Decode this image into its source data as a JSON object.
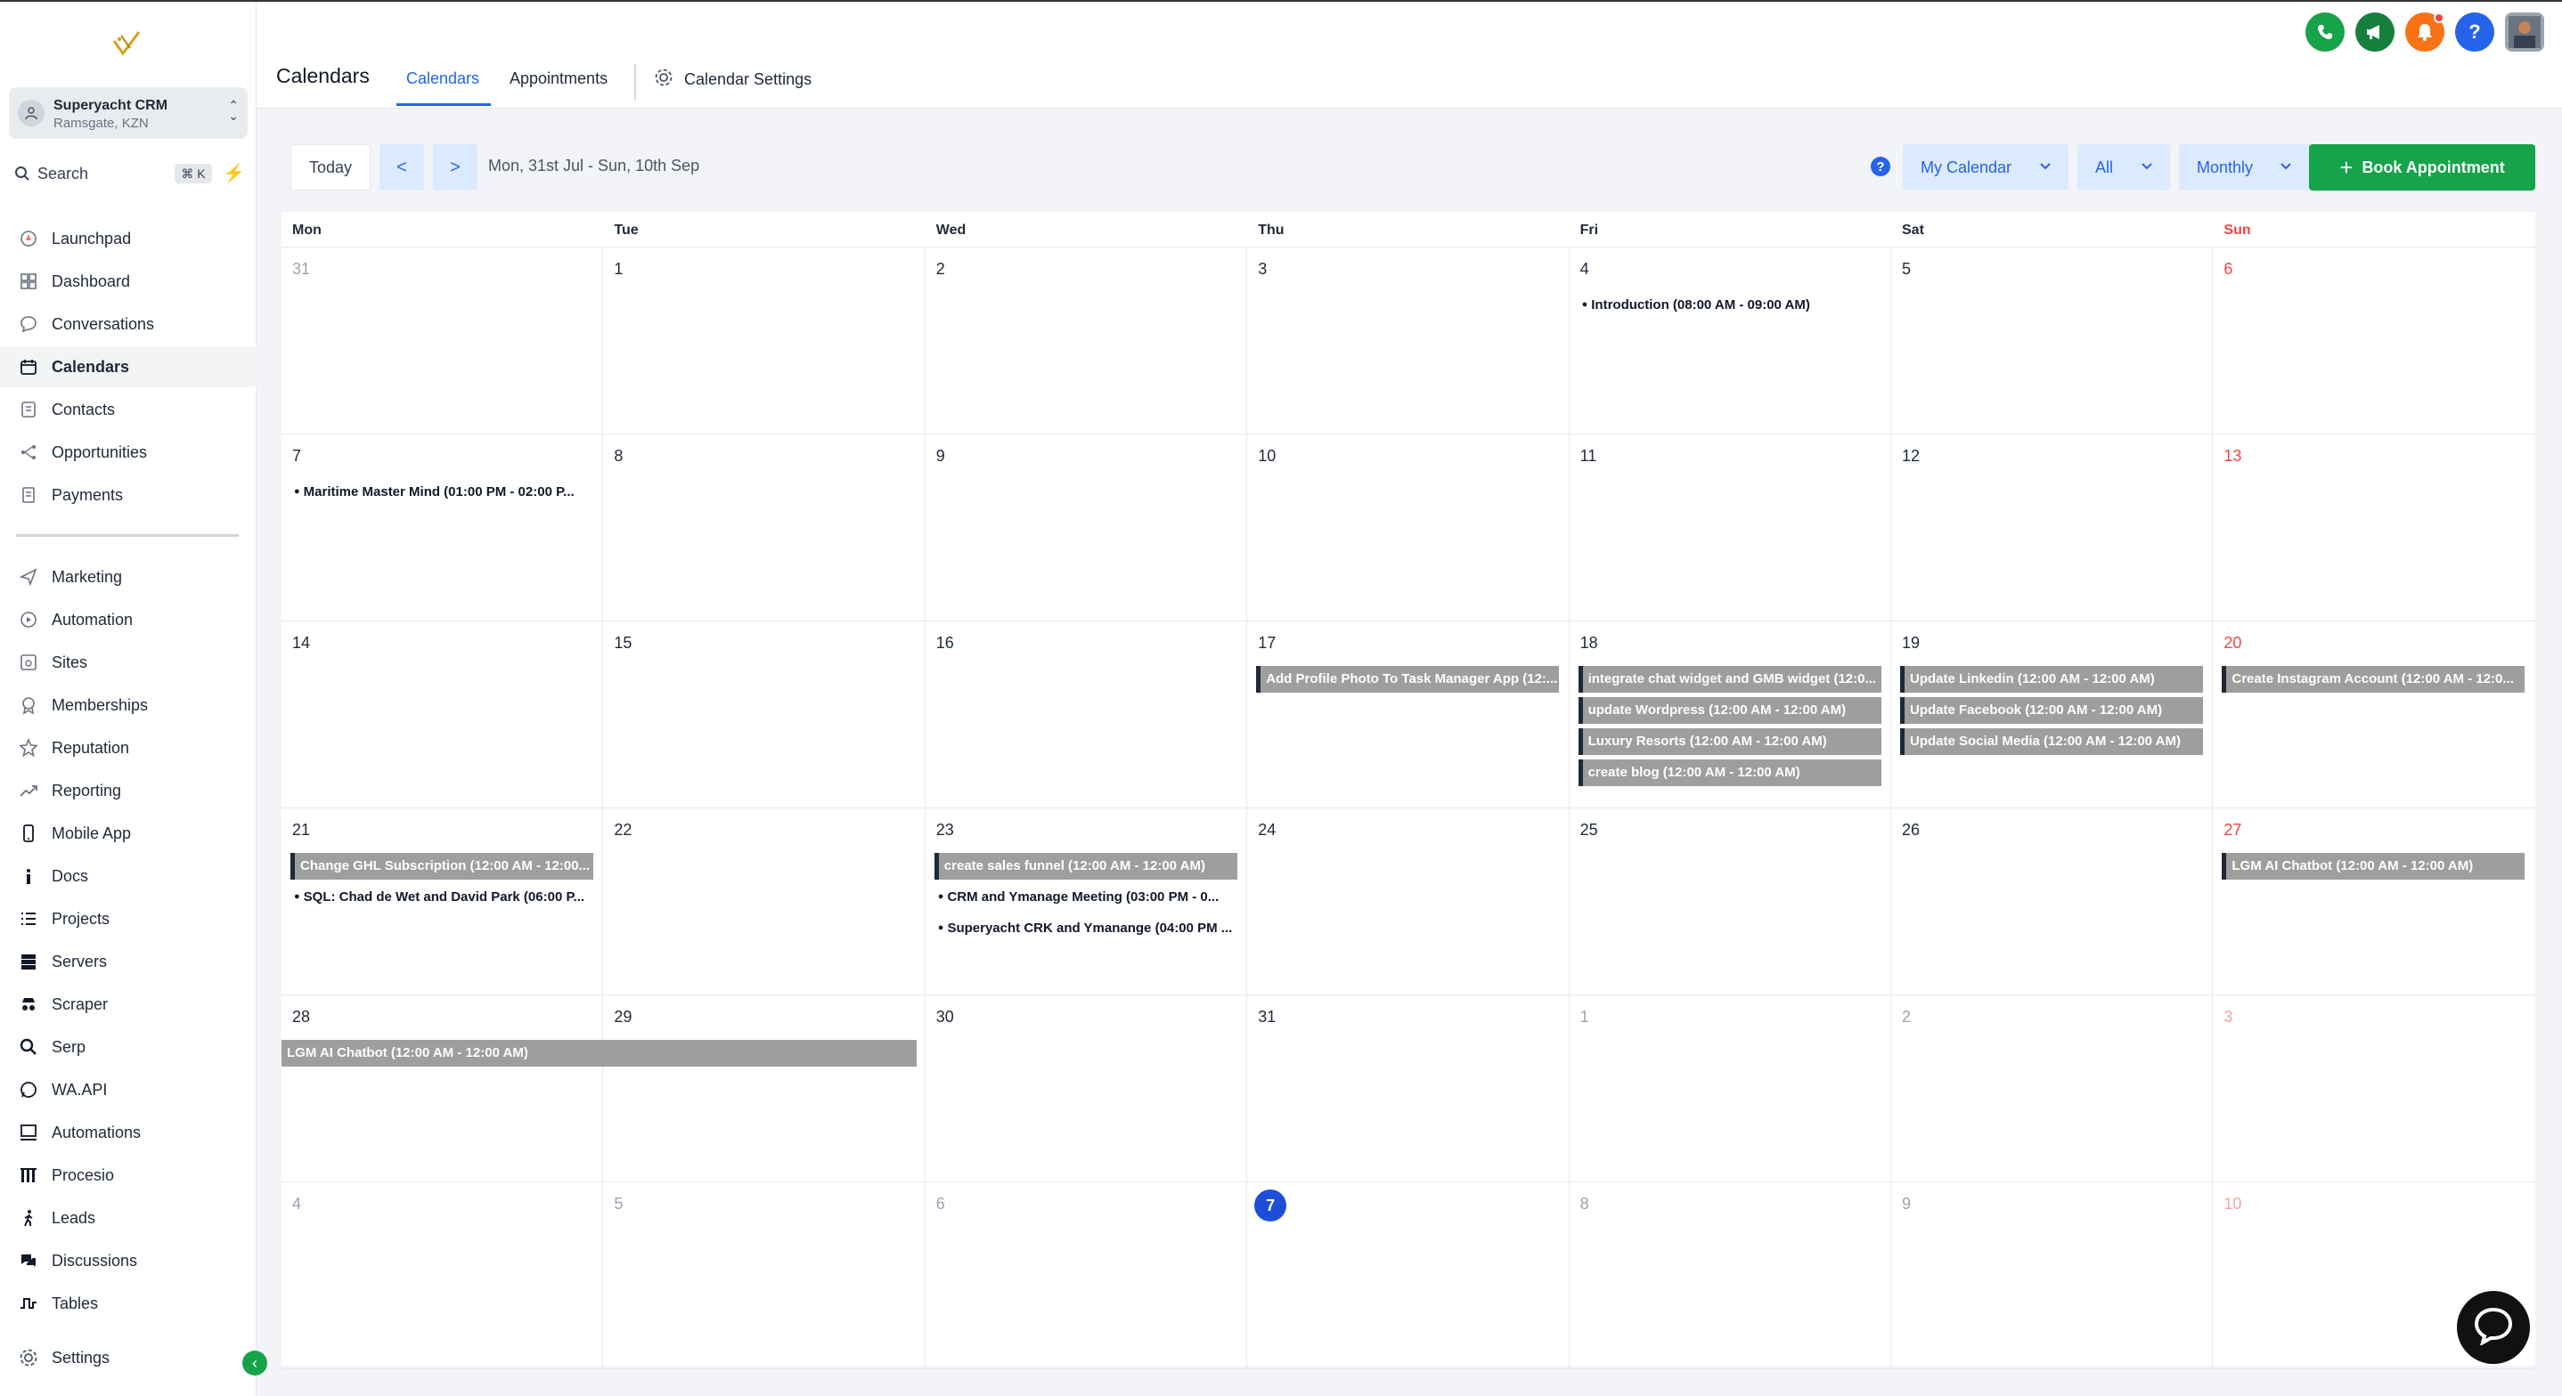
{
  "app": {
    "account_name": "Superyacht CRM",
    "account_location": "Ramsgate, KZN",
    "search_label": "Search",
    "search_shortcut": "⌘ K"
  },
  "sidebar": {
    "items": [
      {
        "label": "Launchpad",
        "icon": "rocket-icon"
      },
      {
        "label": "Dashboard",
        "icon": "grid-icon"
      },
      {
        "label": "Conversations",
        "icon": "chat-icon"
      },
      {
        "label": "Calendars",
        "icon": "calendar-icon",
        "active": true
      },
      {
        "label": "Contacts",
        "icon": "contacts-icon"
      },
      {
        "label": "Opportunities",
        "icon": "network-icon"
      },
      {
        "label": "Payments",
        "icon": "invoice-icon"
      }
    ],
    "items2": [
      {
        "label": "Marketing",
        "icon": "send-icon"
      },
      {
        "label": "Automation",
        "icon": "automation-icon"
      },
      {
        "label": "Sites",
        "icon": "sites-icon"
      },
      {
        "label": "Memberships",
        "icon": "badge-icon"
      },
      {
        "label": "Reputation",
        "icon": "star-icon"
      },
      {
        "label": "Reporting",
        "icon": "trend-icon"
      },
      {
        "label": "Mobile App",
        "icon": "phone-icon"
      },
      {
        "label": "Docs",
        "icon": "info-icon"
      },
      {
        "label": "Projects",
        "icon": "list-icon"
      },
      {
        "label": "Servers",
        "icon": "server-icon"
      },
      {
        "label": "Scraper",
        "icon": "spy-icon"
      },
      {
        "label": "Serp",
        "icon": "magnifier-icon"
      },
      {
        "label": "WA.API",
        "icon": "whatsapp-icon"
      },
      {
        "label": "Automations",
        "icon": "monitor-icon"
      },
      {
        "label": "Procesio",
        "icon": "procesio-icon"
      },
      {
        "label": "Leads",
        "icon": "walking-icon"
      },
      {
        "label": "Discussions",
        "icon": "comments-icon"
      },
      {
        "label": "Tables",
        "icon": "tables-icon"
      }
    ],
    "settings_label": "Settings"
  },
  "header": {
    "title": "Calendars",
    "tabs": [
      "Calendars",
      "Appointments",
      "Calendar Settings"
    ]
  },
  "toolbar": {
    "today": "Today",
    "prev": "<",
    "next": ">",
    "date_range": "Mon, 31st Jul - Sun, 10th Sep",
    "calendar_select": "My Calendar",
    "filter_select": "All",
    "view_select": "Monthly",
    "book_label": "Book Appointment"
  },
  "colors": {
    "accent": "#2563eb",
    "primary_green": "#16a34a",
    "event_bar": "#9e9e9e",
    "weekend_red": "#ef4444"
  },
  "calendar": {
    "days_of_week": [
      "Mon",
      "Tue",
      "Wed",
      "Thu",
      "Fri",
      "Sat",
      "Sun"
    ],
    "weeks": [
      [
        {
          "day": "31",
          "other": true,
          "events": []
        },
        {
          "day": "1",
          "events": []
        },
        {
          "day": "2",
          "events": []
        },
        {
          "day": "3",
          "events": []
        },
        {
          "day": "4",
          "events": [
            {
              "type": "dot",
              "title": "Introduction (08:00 AM - 09:00 AM)"
            }
          ]
        },
        {
          "day": "5",
          "events": []
        },
        {
          "day": "6",
          "events": []
        }
      ],
      [
        {
          "day": "7",
          "events": [
            {
              "type": "dot",
              "title": "Maritime Master Mind (01:00 PM - 02:00 P..."
            }
          ]
        },
        {
          "day": "8",
          "events": []
        },
        {
          "day": "9",
          "events": []
        },
        {
          "day": "10",
          "events": []
        },
        {
          "day": "11",
          "events": []
        },
        {
          "day": "12",
          "events": []
        },
        {
          "day": "13",
          "events": []
        }
      ],
      [
        {
          "day": "14",
          "events": []
        },
        {
          "day": "15",
          "events": []
        },
        {
          "day": "16",
          "events": []
        },
        {
          "day": "17",
          "events": [
            {
              "type": "bar",
              "title": "Add Profile Photo To Task Manager App (12:..."
            }
          ]
        },
        {
          "day": "18",
          "events": [
            {
              "type": "bar",
              "title": "integrate chat widget and GMB widget (12:0..."
            },
            {
              "type": "bar",
              "title": "update Wordpress (12:00 AM - 12:00 AM)"
            },
            {
              "type": "bar",
              "title": "Luxury Resorts (12:00 AM - 12:00 AM)"
            },
            {
              "type": "bar",
              "title": "create blog (12:00 AM - 12:00 AM)"
            }
          ]
        },
        {
          "day": "19",
          "events": [
            {
              "type": "bar",
              "title": "Update Linkedin (12:00 AM - 12:00 AM)"
            },
            {
              "type": "bar",
              "title": "Update Facebook (12:00 AM - 12:00 AM)"
            },
            {
              "type": "bar",
              "title": "Update Social Media (12:00 AM - 12:00 AM)"
            }
          ]
        },
        {
          "day": "20",
          "events": [
            {
              "type": "bar",
              "title": "Create Instagram Account (12:00 AM - 12:0..."
            }
          ]
        }
      ],
      [
        {
          "day": "21",
          "events": [
            {
              "type": "bar",
              "title": "Change GHL Subscription (12:00 AM - 12:00..."
            },
            {
              "type": "dot",
              "title": "SQL: Chad de Wet and David Park (06:00 P..."
            }
          ]
        },
        {
          "day": "22",
          "events": []
        },
        {
          "day": "23",
          "events": [
            {
              "type": "bar",
              "title": "create sales funnel (12:00 AM - 12:00 AM)"
            },
            {
              "type": "dot",
              "title": "CRM and Ymanage Meeting (03:00 PM - 0..."
            },
            {
              "type": "dot",
              "title": "Superyacht CRK and Ymanange (04:00 PM ..."
            }
          ]
        },
        {
          "day": "24",
          "events": []
        },
        {
          "day": "25",
          "events": []
        },
        {
          "day": "26",
          "events": []
        },
        {
          "day": "27",
          "events": [
            {
              "type": "bar",
              "title": "LGM AI Chatbot (12:00 AM - 12:00 AM)"
            }
          ]
        }
      ],
      [
        {
          "day": "28",
          "events": []
        },
        {
          "day": "29",
          "events": []
        },
        {
          "day": "30",
          "events": []
        },
        {
          "day": "31",
          "events": []
        },
        {
          "day": "1",
          "other": true,
          "events": []
        },
        {
          "day": "2",
          "other": true,
          "events": []
        },
        {
          "day": "3",
          "other": true,
          "events": []
        }
      ],
      [
        {
          "day": "4",
          "other": true,
          "events": []
        },
        {
          "day": "5",
          "other": true,
          "events": []
        },
        {
          "day": "6",
          "other": true,
          "events": []
        },
        {
          "day": "7",
          "today": true,
          "events": []
        },
        {
          "day": "8",
          "other": true,
          "events": []
        },
        {
          "day": "9",
          "other": true,
          "events": []
        },
        {
          "day": "10",
          "other": true,
          "events": []
        }
      ]
    ],
    "spanning_event": {
      "title": "LGM AI Chatbot (12:00 AM - 12:00 AM)",
      "week": 4,
      "start_col": 0,
      "span_cols": 2
    }
  }
}
